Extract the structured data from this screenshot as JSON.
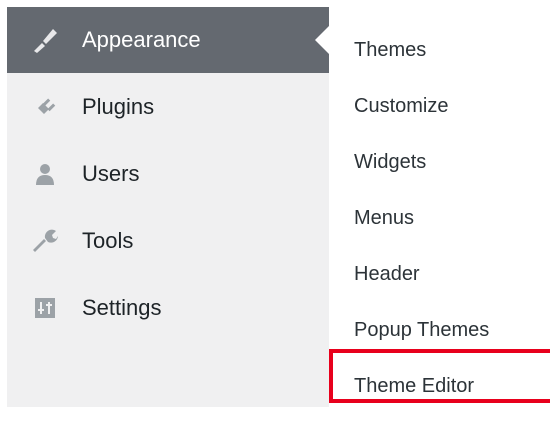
{
  "sidebar": {
    "items": [
      {
        "label": "Appearance",
        "icon": "paintbrush-icon",
        "active": true
      },
      {
        "label": "Plugins",
        "icon": "plugins-icon",
        "active": false
      },
      {
        "label": "Users",
        "icon": "users-icon",
        "active": false
      },
      {
        "label": "Tools",
        "icon": "wrench-icon",
        "active": false
      },
      {
        "label": "Settings",
        "icon": "settings-icon",
        "active": false
      }
    ]
  },
  "submenu": {
    "items": [
      {
        "label": "Themes"
      },
      {
        "label": "Customize"
      },
      {
        "label": "Widgets"
      },
      {
        "label": "Menus"
      },
      {
        "label": "Header"
      },
      {
        "label": "Popup Themes"
      },
      {
        "label": "Theme Editor",
        "highlighted": true
      }
    ]
  },
  "colors": {
    "sidebar_bg": "#f0f0f1",
    "active_bg": "#646970",
    "highlight": "#e8001c"
  }
}
